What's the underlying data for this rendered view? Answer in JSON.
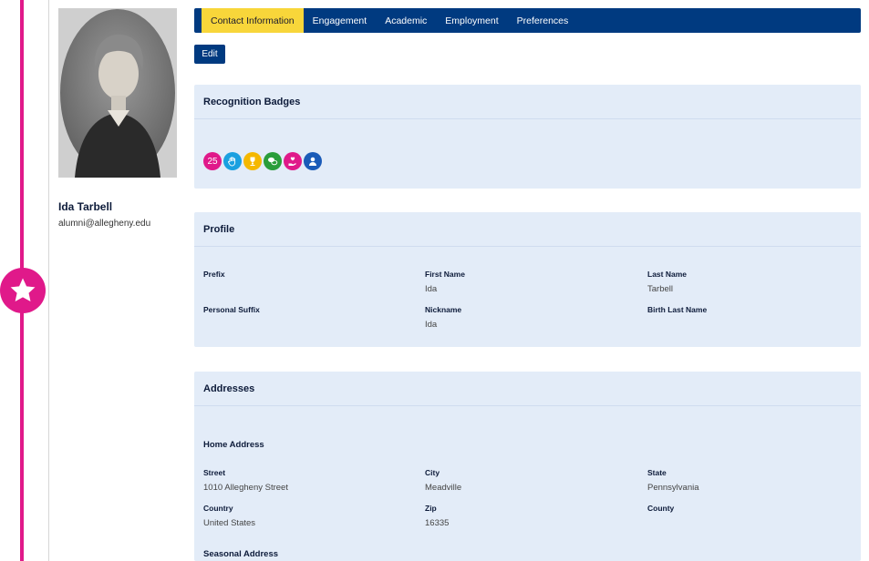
{
  "user": {
    "name": "Ida Tarbell",
    "email": "alumni@allegheny.edu"
  },
  "tabs": [
    {
      "label": "Contact Information",
      "active": true
    },
    {
      "label": "Engagement",
      "active": false
    },
    {
      "label": "Academic",
      "active": false
    },
    {
      "label": "Employment",
      "active": false
    },
    {
      "label": "Preferences",
      "active": false
    }
  ],
  "edit_label": "Edit",
  "badges_panel": {
    "title": "Recognition Badges",
    "badges": [
      {
        "icon": "number-25-badge",
        "text": "25",
        "color": "#e0198a"
      },
      {
        "icon": "hand-icon",
        "text": "",
        "color": "#1aa0e0"
      },
      {
        "icon": "trophy-icon",
        "text": "",
        "color": "#f5b800"
      },
      {
        "icon": "chat-icon",
        "text": "",
        "color": "#2a9d3a"
      },
      {
        "icon": "hand-heart-icon",
        "text": "",
        "color": "#e0198a"
      },
      {
        "icon": "person-icon",
        "text": "",
        "color": "#1a5bb8"
      }
    ]
  },
  "profile_panel": {
    "title": "Profile",
    "fields": {
      "prefix": {
        "label": "Prefix",
        "value": ""
      },
      "first_name": {
        "label": "First Name",
        "value": "Ida"
      },
      "last_name": {
        "label": "Last Name",
        "value": "Tarbell"
      },
      "personal_suffix": {
        "label": "Personal Suffix",
        "value": ""
      },
      "nickname": {
        "label": "Nickname",
        "value": "Ida"
      },
      "birth_last_name": {
        "label": "Birth Last Name",
        "value": ""
      }
    }
  },
  "addresses_panel": {
    "title": "Addresses",
    "home_title": "Home Address",
    "fields": {
      "street": {
        "label": "Street",
        "value": "1010 Allegheny Street"
      },
      "city": {
        "label": "City",
        "value": "Meadville"
      },
      "state": {
        "label": "State",
        "value": "Pennsylvania"
      },
      "country": {
        "label": "Country",
        "value": "United States"
      },
      "zip": {
        "label": "Zip",
        "value": "16335"
      },
      "county": {
        "label": "County",
        "value": ""
      }
    },
    "seasonal_title": "Seasonal Address"
  }
}
